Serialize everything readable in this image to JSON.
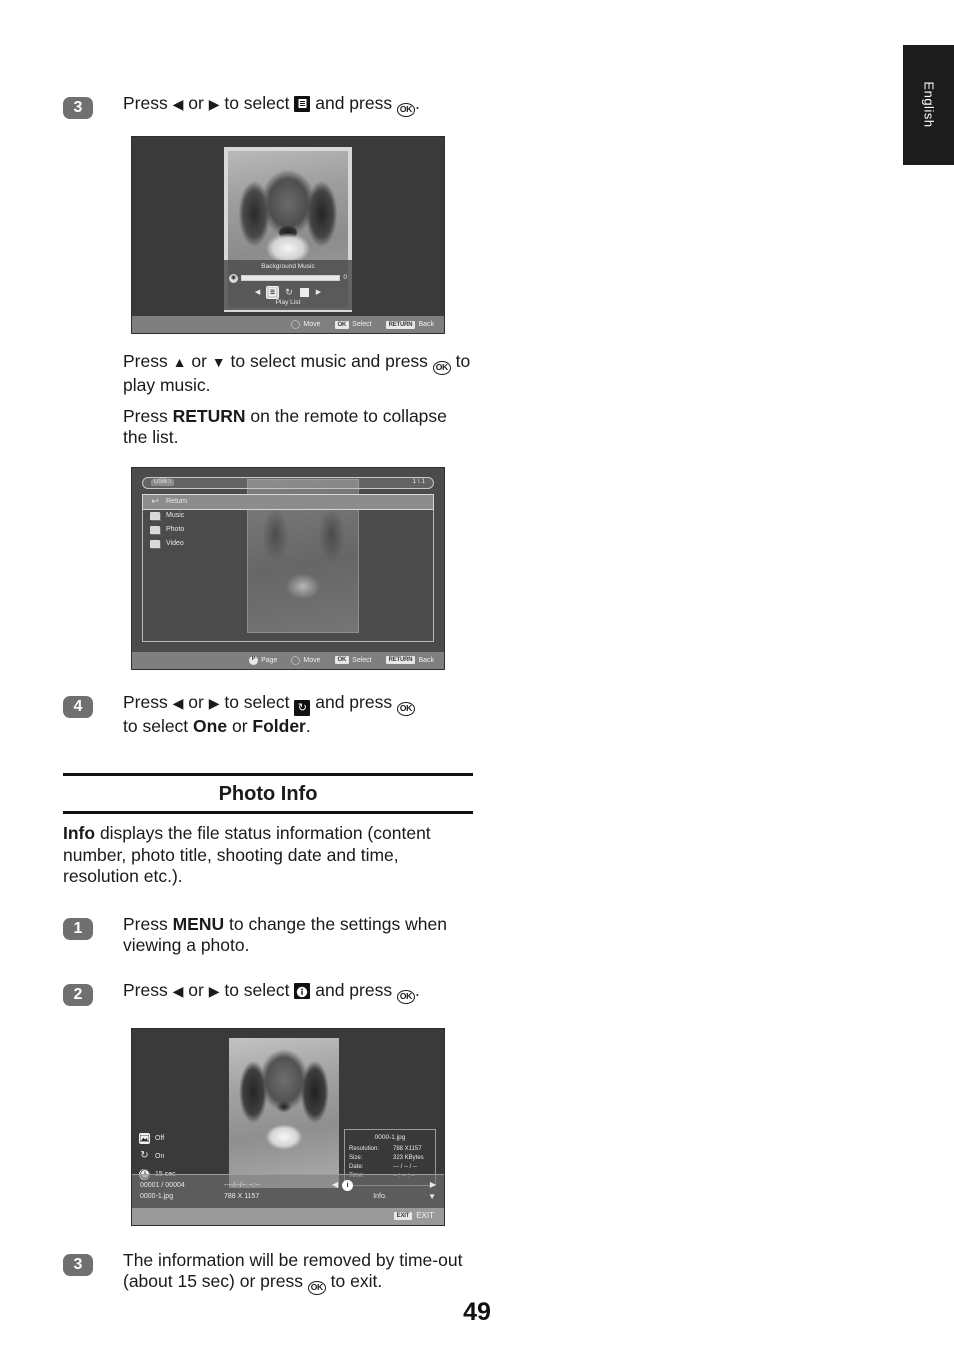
{
  "language_tab": "English",
  "page_number": "49",
  "steps": {
    "s3_bgm": {
      "number": "3",
      "text_before": "Press ",
      "arrow_left": "◀",
      "or": " or ",
      "arrow_right": "▶",
      "text_mid": " to select ",
      "icon": "playlist-icon",
      "text_after": " and press ",
      "ok": "OK",
      "period": "."
    },
    "s3_note": {
      "line1_a": "Press ",
      "up": "▲",
      "or": " or ",
      "down": "▼",
      "line1_b": " to select music and press ",
      "ok": "OK",
      "line1_c": " to play music.",
      "line2_a": "Press ",
      "return_bold": "RETURN",
      "line2_b": " on the remote to collapse the list."
    },
    "s4": {
      "number": "4",
      "text_before": "Press ",
      "arrow_left": "◀",
      "or": " or ",
      "arrow_right": "▶",
      "text_mid": " to select ",
      "icon": "repeat-icon",
      "text_after": " and press ",
      "ok": "OK",
      "line2_a": "to select ",
      "one": "One",
      "line2_or": " or ",
      "folder": "Folder",
      "period": "."
    },
    "s1_info": {
      "number": "1",
      "text_a": "Press ",
      "menu_bold": "MENU",
      "text_b": " to change the settings when viewing a photo."
    },
    "s2_info": {
      "number": "2",
      "text_before": "Press ",
      "arrow_left": "◀",
      "or": " or ",
      "arrow_right": "▶",
      "text_mid": " to select ",
      "icon": "info-icon",
      "text_after": " and press ",
      "ok": "OK",
      "period": "."
    },
    "s3_info": {
      "number": "3",
      "text_a": "The information will be removed by time-out (about 15 sec) or press ",
      "ok": "OK",
      "text_b": " to exit."
    }
  },
  "section": {
    "title": "Photo Info",
    "body_bold": "Info",
    "body_rest": " displays the file status information (content number, photo title, shooting date and time, resolution etc.)."
  },
  "shot_bgm": {
    "panel_title": "Background Music",
    "volume_value": "0",
    "speaker_icon": "◉",
    "left_arrow": "◀",
    "right_arrow": "▶",
    "icon_playlist": "☰",
    "icon_repeat": "↻",
    "icon_stop": "stop-icon",
    "playlist_label": "Play List",
    "hints": [
      {
        "key": "✥",
        "label": "Move",
        "type": "dot"
      },
      {
        "key": "OK",
        "label": "Select",
        "type": "badge"
      },
      {
        "key": "RETURN",
        "label": "Back",
        "type": "badge"
      }
    ]
  },
  "shot_usb": {
    "path": "USB:\\",
    "page_indicator": "1 \\ 1",
    "items": [
      {
        "label": "Return",
        "icon": "return-arrow-icon",
        "selected": true
      },
      {
        "label": "Music",
        "icon": "folder-icon",
        "selected": false
      },
      {
        "label": "Photo",
        "icon": "folder-icon",
        "selected": false
      },
      {
        "label": "Video",
        "icon": "folder-icon",
        "selected": false
      }
    ],
    "hints": [
      {
        "key": "P",
        "label": "Page",
        "type": "dot"
      },
      {
        "key": "✥",
        "label": "Move",
        "type": "dot"
      },
      {
        "key": "OK",
        "label": "Select",
        "type": "badge"
      },
      {
        "key": "RETURN",
        "label": "Back",
        "type": "badge"
      }
    ]
  },
  "shot_info": {
    "options": [
      {
        "icon": "slideshow-icon",
        "label": "Off"
      },
      {
        "icon": "repeat-icon",
        "label": "On"
      },
      {
        "icon": "clock-icon",
        "label": "15 sec"
      }
    ],
    "info_box": {
      "file_name": "0000-1.jpg",
      "rows": [
        {
          "key": "Resolution:",
          "value": "788 X1157"
        },
        {
          "key": "Size:",
          "value": "323 KBytes"
        },
        {
          "key": "Date:",
          "value": "--- / -- / --"
        },
        {
          "key": "Time:",
          "value": "-- : -- : --"
        }
      ]
    },
    "status": {
      "count": "00001 / 00004",
      "file_name": "0000-1.jpg",
      "datetime": "----/--/-- --:--",
      "resolution": "788 X 1157",
      "info_label": "Info.",
      "prev_arrow": "◀",
      "next_arrow": "▶",
      "down_arrow": "▼",
      "center_icon": "info-icon"
    },
    "exit": {
      "key": "EXIT",
      "label": "EXIT"
    }
  }
}
